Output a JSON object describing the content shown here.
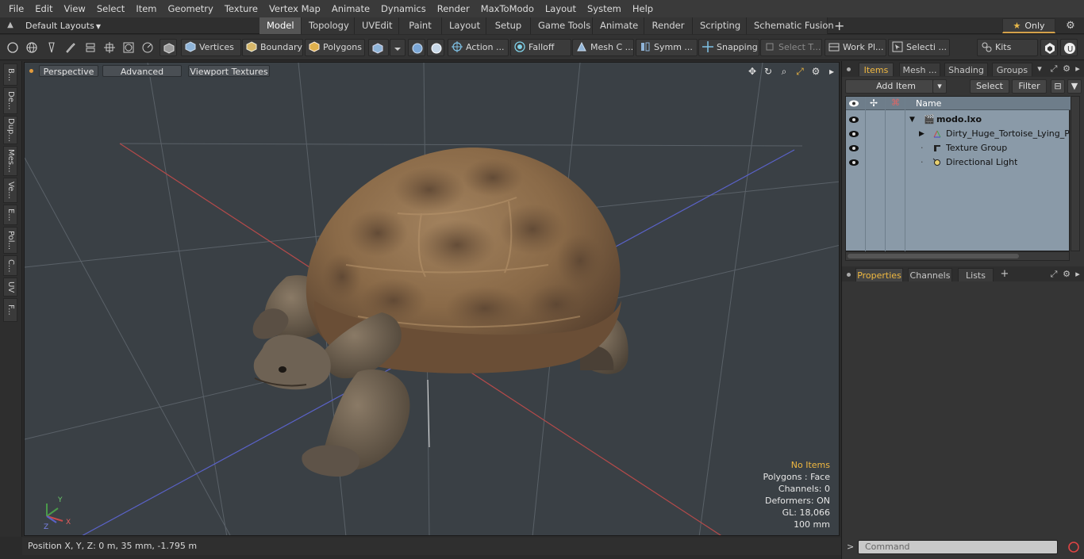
{
  "menu": [
    "File",
    "Edit",
    "View",
    "Select",
    "Item",
    "Geometry",
    "Texture",
    "Vertex Map",
    "Animate",
    "Dynamics",
    "Render",
    "MaxToModo",
    "Layout",
    "System",
    "Help"
  ],
  "layouts": {
    "dropdown_label": "Default Layouts"
  },
  "layout_tabs": [
    "Model",
    "Topology",
    "UVEdit",
    "Paint",
    "Layout",
    "Setup",
    "Game Tools",
    "Animate",
    "Render",
    "Scripting",
    "Schematic Fusion"
  ],
  "layout_tab_active": "Model",
  "only_label": "Only",
  "toolbar": {
    "vertices": "Vertices",
    "boundary": "Boundary",
    "polygons": "Polygons",
    "action": "Action ...",
    "falloff": "Falloff",
    "mesh_c": "Mesh C ...",
    "symm": "Symm ...",
    "snapping": "Snapping",
    "select_t": "Select T...",
    "work_pl": "Work Pl...",
    "selecti": "Selecti ...",
    "kits": "Kits"
  },
  "left_tabs": [
    "B...",
    "De...",
    "Dup...",
    "Mes...",
    "Ve...",
    "E...",
    "Pol...",
    "C...",
    "UV",
    "F..."
  ],
  "viewport": {
    "view_mode": "Perspective",
    "advanced": "Advanced",
    "textures": "Viewport Textures",
    "info": {
      "no_items": "No Items",
      "polygons": "Polygons : Face",
      "channels": "Channels: 0",
      "deformers": "Deformers: ON",
      "gl": "GL: 18,066",
      "scale": "100 mm"
    },
    "axis_labels": {
      "x": "X",
      "y": "Y",
      "z": "Z"
    }
  },
  "status": {
    "position": "Position X, Y, Z:   0 m, 35 mm, -1.795 m"
  },
  "right_panel": {
    "tabs": [
      "Items",
      "Mesh ...",
      "Shading",
      "Groups"
    ],
    "tab_active": "Items",
    "add_item": "Add Item",
    "select": "Select",
    "filter": "Filter",
    "column_name": "Name",
    "items": [
      {
        "name": "modo.lxo",
        "icon": "scene-icon",
        "bold": true
      },
      {
        "name": "Dirty_Huge_Tortoise_Lying_P ...",
        "icon": "mesh-icon"
      },
      {
        "name": "Texture Group",
        "icon": "texture-group-icon"
      },
      {
        "name": "Directional Light",
        "icon": "light-icon"
      }
    ],
    "bottom_tabs": [
      "Properties",
      "Channels",
      "Lists"
    ],
    "bottom_tab_active": "Properties",
    "command_placeholder": "Command"
  },
  "colors": {
    "accent": "#f0b840",
    "viewport_bg": "#3a4045",
    "items_bg": "#8a9aa8",
    "tortoise_shell": "#8b6a48"
  }
}
